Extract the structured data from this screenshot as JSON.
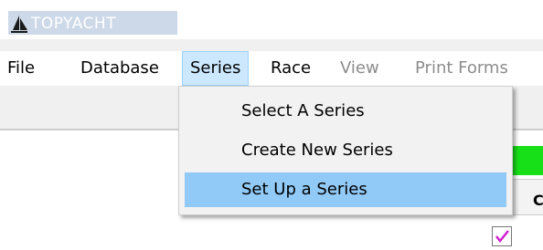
{
  "app": {
    "title": "TOPYACHT",
    "logo_icon": "sailboat-icon"
  },
  "menubar": {
    "items": [
      {
        "label": "File",
        "enabled": true
      },
      {
        "label": "Database",
        "enabled": true
      },
      {
        "label": "Series",
        "enabled": true,
        "active": true
      },
      {
        "label": "Race",
        "enabled": true
      },
      {
        "label": "View",
        "enabled": false
      },
      {
        "label": "Print Forms",
        "enabled": false
      }
    ]
  },
  "series_menu": {
    "items": [
      {
        "label": "Select  A Series",
        "highlighted": false
      },
      {
        "label": "Create New Series",
        "highlighted": false
      },
      {
        "label": "Set Up a Series",
        "highlighted": true
      }
    ]
  },
  "right_panel": {
    "header_text": "C",
    "checkbox_checked": true,
    "checkbox_icon": "checkmark-icon"
  },
  "colors": {
    "green_panel": "#18e018",
    "menu_highlight": "#91c9f7",
    "active_menu_bg": "#cce8ff",
    "checkmark": "#d020d0"
  }
}
